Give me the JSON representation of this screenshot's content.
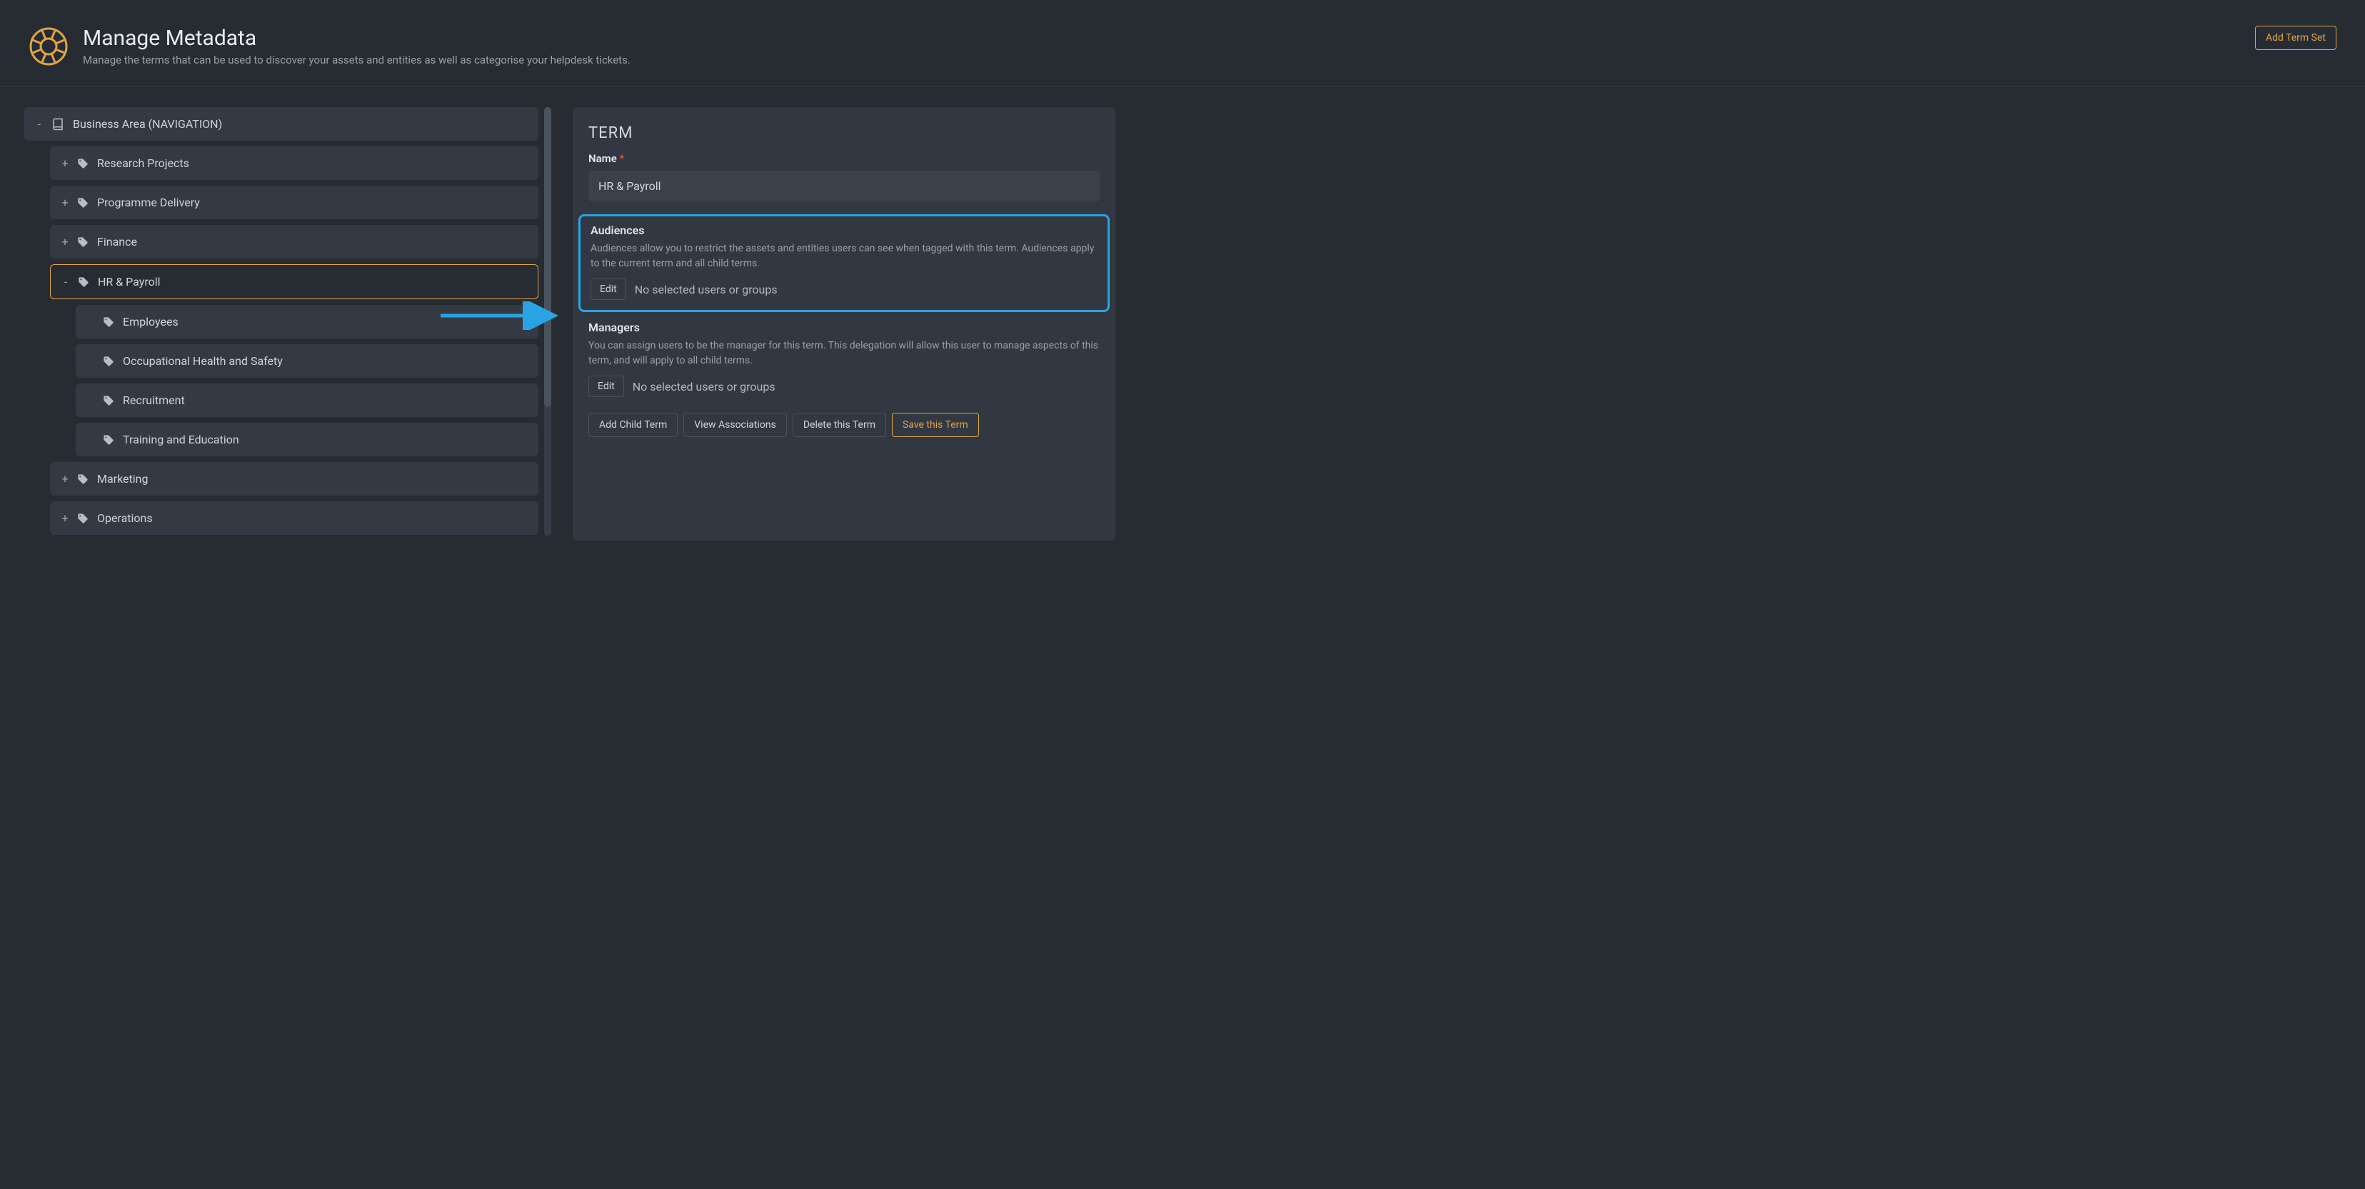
{
  "header": {
    "title": "Manage Metadata",
    "subtitle": "Manage the terms that can be used to discover your assets and entities as well as categorise your helpdesk tickets.",
    "add_button": "Add Term Set"
  },
  "tree": {
    "root": {
      "expander": "-",
      "label": "Business Area (NAVIGATION)"
    },
    "items": [
      {
        "expander": "+",
        "label": "Research Projects",
        "level": 1
      },
      {
        "expander": "+",
        "label": "Programme Delivery",
        "level": 1
      },
      {
        "expander": "+",
        "label": "Finance",
        "level": 1
      },
      {
        "expander": "-",
        "label": "HR & Payroll",
        "level": 1,
        "selected": true
      },
      {
        "expander": "",
        "label": "Employees",
        "level": 2
      },
      {
        "expander": "",
        "label": "Occupational Health and Safety",
        "level": 2
      },
      {
        "expander": "",
        "label": "Recruitment",
        "level": 2
      },
      {
        "expander": "",
        "label": "Training and Education",
        "level": 2
      },
      {
        "expander": "+",
        "label": "Marketing",
        "level": 1
      },
      {
        "expander": "+",
        "label": "Operations",
        "level": 1
      }
    ]
  },
  "detail": {
    "section": "TERM",
    "name_label": "Name",
    "name_value": "HR & Payroll",
    "audiences": {
      "label": "Audiences",
      "help": "Audiences allow you to restrict the assets and entities users can see when tagged with this term. Audiences apply to the current term and all child terms.",
      "edit": "Edit",
      "status": "No selected users or groups"
    },
    "managers": {
      "label": "Managers",
      "help": "You can assign users to be the manager for this term. This delegation will allow this user to manage aspects of this term, and will apply to all child terms.",
      "edit": "Edit",
      "status": "No selected users or groups"
    },
    "actions": {
      "add_child": "Add Child Term",
      "view_assoc": "View Associations",
      "delete": "Delete this Term",
      "save": "Save this Term"
    }
  }
}
